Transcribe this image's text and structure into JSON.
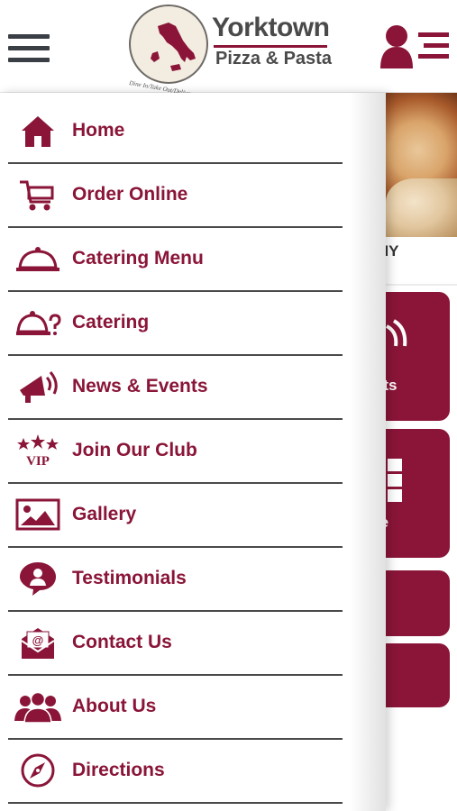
{
  "header": {
    "logo": {
      "line1": "Yorktown",
      "line2": "Pizza & Pasta",
      "tagline": "Dine In/Take Out/Delivery"
    },
    "menu_icon": "hamburger-menu-icon",
    "user_icon": "user-list-icon"
  },
  "background": {
    "location_fragment": "s, NY",
    "tile_fragments": [
      "nts",
      "re"
    ]
  },
  "drawer": {
    "items": [
      {
        "label": "Home",
        "icon": "home-icon"
      },
      {
        "label": "Order Online",
        "icon": "cart-icon"
      },
      {
        "label": "Catering Menu",
        "icon": "cloche-icon"
      },
      {
        "label": "Catering",
        "icon": "cloche-question-icon"
      },
      {
        "label": "News & Events",
        "icon": "megaphone-icon"
      },
      {
        "label": "Join Our Club",
        "icon": "vip-stars-icon"
      },
      {
        "label": "Gallery",
        "icon": "image-icon"
      },
      {
        "label": "Testimonials",
        "icon": "testimonial-icon"
      },
      {
        "label": "Contact Us",
        "icon": "envelope-icon"
      },
      {
        "label": "About Us",
        "icon": "group-icon"
      },
      {
        "label": "Directions",
        "icon": "compass-icon"
      }
    ]
  },
  "colors": {
    "accent": "#8a1538",
    "divider": "#4a4a4a",
    "header_icon": "#3a3f46"
  }
}
